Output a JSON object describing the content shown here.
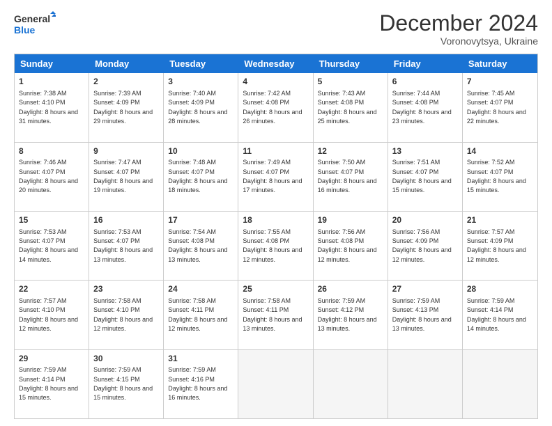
{
  "header": {
    "logo_line1": "General",
    "logo_line2": "Blue",
    "title": "December 2024",
    "subtitle": "Voronovytsya, Ukraine"
  },
  "days": [
    "Sunday",
    "Monday",
    "Tuesday",
    "Wednesday",
    "Thursday",
    "Friday",
    "Saturday"
  ],
  "weeks": [
    [
      {
        "num": "1",
        "rise": "7:38 AM",
        "set": "4:10 PM",
        "daylight": "8 hours and 31 minutes."
      },
      {
        "num": "2",
        "rise": "7:39 AM",
        "set": "4:09 PM",
        "daylight": "8 hours and 29 minutes."
      },
      {
        "num": "3",
        "rise": "7:40 AM",
        "set": "4:09 PM",
        "daylight": "8 hours and 28 minutes."
      },
      {
        "num": "4",
        "rise": "7:42 AM",
        "set": "4:08 PM",
        "daylight": "8 hours and 26 minutes."
      },
      {
        "num": "5",
        "rise": "7:43 AM",
        "set": "4:08 PM",
        "daylight": "8 hours and 25 minutes."
      },
      {
        "num": "6",
        "rise": "7:44 AM",
        "set": "4:08 PM",
        "daylight": "8 hours and 23 minutes."
      },
      {
        "num": "7",
        "rise": "7:45 AM",
        "set": "4:07 PM",
        "daylight": "8 hours and 22 minutes."
      }
    ],
    [
      {
        "num": "8",
        "rise": "7:46 AM",
        "set": "4:07 PM",
        "daylight": "8 hours and 20 minutes."
      },
      {
        "num": "9",
        "rise": "7:47 AM",
        "set": "4:07 PM",
        "daylight": "8 hours and 19 minutes."
      },
      {
        "num": "10",
        "rise": "7:48 AM",
        "set": "4:07 PM",
        "daylight": "8 hours and 18 minutes."
      },
      {
        "num": "11",
        "rise": "7:49 AM",
        "set": "4:07 PM",
        "daylight": "8 hours and 17 minutes."
      },
      {
        "num": "12",
        "rise": "7:50 AM",
        "set": "4:07 PM",
        "daylight": "8 hours and 16 minutes."
      },
      {
        "num": "13",
        "rise": "7:51 AM",
        "set": "4:07 PM",
        "daylight": "8 hours and 15 minutes."
      },
      {
        "num": "14",
        "rise": "7:52 AM",
        "set": "4:07 PM",
        "daylight": "8 hours and 15 minutes."
      }
    ],
    [
      {
        "num": "15",
        "rise": "7:53 AM",
        "set": "4:07 PM",
        "daylight": "8 hours and 14 minutes."
      },
      {
        "num": "16",
        "rise": "7:53 AM",
        "set": "4:07 PM",
        "daylight": "8 hours and 13 minutes."
      },
      {
        "num": "17",
        "rise": "7:54 AM",
        "set": "4:08 PM",
        "daylight": "8 hours and 13 minutes."
      },
      {
        "num": "18",
        "rise": "7:55 AM",
        "set": "4:08 PM",
        "daylight": "8 hours and 12 minutes."
      },
      {
        "num": "19",
        "rise": "7:56 AM",
        "set": "4:08 PM",
        "daylight": "8 hours and 12 minutes."
      },
      {
        "num": "20",
        "rise": "7:56 AM",
        "set": "4:09 PM",
        "daylight": "8 hours and 12 minutes."
      },
      {
        "num": "21",
        "rise": "7:57 AM",
        "set": "4:09 PM",
        "daylight": "8 hours and 12 minutes."
      }
    ],
    [
      {
        "num": "22",
        "rise": "7:57 AM",
        "set": "4:10 PM",
        "daylight": "8 hours and 12 minutes."
      },
      {
        "num": "23",
        "rise": "7:58 AM",
        "set": "4:10 PM",
        "daylight": "8 hours and 12 minutes."
      },
      {
        "num": "24",
        "rise": "7:58 AM",
        "set": "4:11 PM",
        "daylight": "8 hours and 12 minutes."
      },
      {
        "num": "25",
        "rise": "7:58 AM",
        "set": "4:11 PM",
        "daylight": "8 hours and 13 minutes."
      },
      {
        "num": "26",
        "rise": "7:59 AM",
        "set": "4:12 PM",
        "daylight": "8 hours and 13 minutes."
      },
      {
        "num": "27",
        "rise": "7:59 AM",
        "set": "4:13 PM",
        "daylight": "8 hours and 13 minutes."
      },
      {
        "num": "28",
        "rise": "7:59 AM",
        "set": "4:14 PM",
        "daylight": "8 hours and 14 minutes."
      }
    ],
    [
      {
        "num": "29",
        "rise": "7:59 AM",
        "set": "4:14 PM",
        "daylight": "8 hours and 15 minutes."
      },
      {
        "num": "30",
        "rise": "7:59 AM",
        "set": "4:15 PM",
        "daylight": "8 hours and 15 minutes."
      },
      {
        "num": "31",
        "rise": "7:59 AM",
        "set": "4:16 PM",
        "daylight": "8 hours and 16 minutes."
      },
      null,
      null,
      null,
      null
    ]
  ],
  "labels": {
    "sunrise": "Sunrise:",
    "sunset": "Sunset:",
    "daylight": "Daylight:"
  }
}
